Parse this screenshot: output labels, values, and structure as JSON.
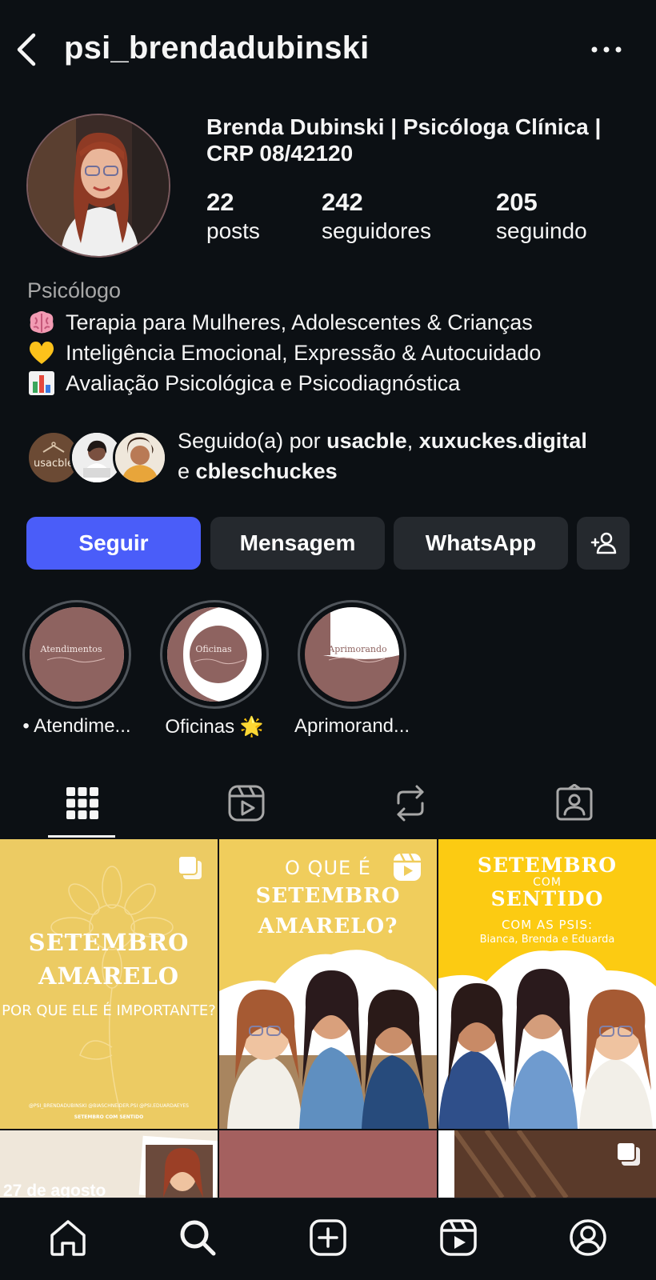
{
  "header": {
    "username": "psi_brendadubinski"
  },
  "profile": {
    "display_name": "Brenda Dubinski | Psicóloga Clínica | CRP 08/42120",
    "stats": {
      "posts_count": "22",
      "posts_label": "posts",
      "followers_count": "242",
      "followers_label": "seguidores",
      "following_count": "205",
      "following_label": "seguindo"
    },
    "category": "Psicólogo",
    "bio": [
      {
        "icon": "brain-emoji",
        "text": "Terapia para Mulheres, Adolescentes & Crianças"
      },
      {
        "icon": "yellow-heart-emoji",
        "text": "Inteligência Emocional, Expressão & Autocuidado"
      },
      {
        "icon": "bar-chart-emoji",
        "text": "Avaliação Psicológica e Psicodiagnóstica"
      }
    ]
  },
  "followed_by": {
    "prefix": "Seguido(a) por",
    "user1": "usacble",
    "sep1": ",",
    "user2": "xuxuckes.digital",
    "conj": "e",
    "user3": "cbleschuckes",
    "avatar1_text": "usacble"
  },
  "actions": {
    "follow": "Seguir",
    "message": "Mensagem",
    "whatsapp": "WhatsApp",
    "follow_color": "#4a5df9"
  },
  "highlights": [
    {
      "label": "• Atendime...",
      "cover_text": "Atendimentos"
    },
    {
      "label": "Oficinas 🌟",
      "cover_text": "Oficinas"
    },
    {
      "label": "Aprimorand...",
      "cover_text": "Aprimorando"
    }
  ],
  "tabs": [
    "grid-icon",
    "reels-icon",
    "reposts-icon",
    "tagged-icon"
  ],
  "posts": [
    {
      "line1": "SETEMBRO",
      "line2": "AMARELO",
      "line3": "POR QUE ELE É IMPORTANTE?",
      "footer": "@PSI_BRENDADUBINSKI  @BIASCHNEIDER.PSI  @PSI.EDUARDAEYES",
      "footer2": "SETEMBRO COM SENTIDO",
      "badge": "carousel-icon"
    },
    {
      "line1": "O QUE É",
      "line2": "SETEMBRO",
      "line3": "AMARELO?",
      "badge": "reels-badge-icon"
    },
    {
      "line1": "SETEMBRO",
      "line2": "COM",
      "line3": "SENTIDO",
      "line4": "COM AS PSIS:",
      "line5": "Bianca, Brenda e Eduarda"
    },
    {
      "line1": "27 de agosto"
    }
  ],
  "colors": {
    "background": "#0c1014",
    "yellow_post": "#eccb63",
    "bright_yellow": "#fccb12",
    "mauve": "#8e6360"
  }
}
